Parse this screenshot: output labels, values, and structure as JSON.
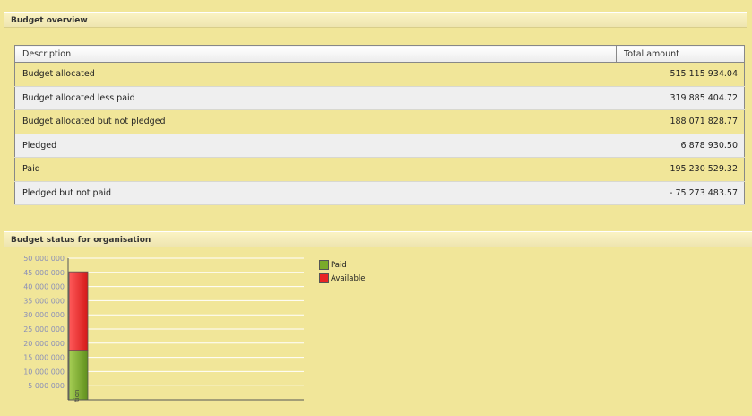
{
  "overview": {
    "header": "Budget overview",
    "columns": {
      "description": "Description",
      "amount": "Total amount"
    },
    "rows": [
      {
        "label": "Budget allocated",
        "amount": "515 115 934.04"
      },
      {
        "label": "Budget allocated less paid",
        "amount": "319 885 404.72"
      },
      {
        "label": "Budget allocated but not pledged",
        "amount": "188 071 828.77"
      },
      {
        "label": "Pledged",
        "amount": "6 878 930.50"
      },
      {
        "label": "Paid",
        "amount": "195 230 529.32"
      },
      {
        "label": "Pledged but not paid",
        "amount": "- 75 273 483.57"
      }
    ]
  },
  "status": {
    "header": "Budget status for organisation",
    "category_label": "tion"
  },
  "chart_data": {
    "type": "bar",
    "stacked": true,
    "categories": [
      "tion"
    ],
    "series": [
      {
        "name": "Paid",
        "values": [
          17500000
        ],
        "color": "#7aab2a"
      },
      {
        "name": "Available",
        "values": [
          27700000
        ],
        "color": "#e82525"
      }
    ],
    "y_ticks": [
      "5 000 000",
      "10 000 000",
      "15 000 000",
      "20 000 000",
      "25 000 000",
      "30 000 000",
      "35 000 000",
      "40 000 000",
      "45 000 000",
      "50 000 000"
    ],
    "ylim": [
      0,
      50000000
    ],
    "grid": true,
    "legend": "right"
  }
}
